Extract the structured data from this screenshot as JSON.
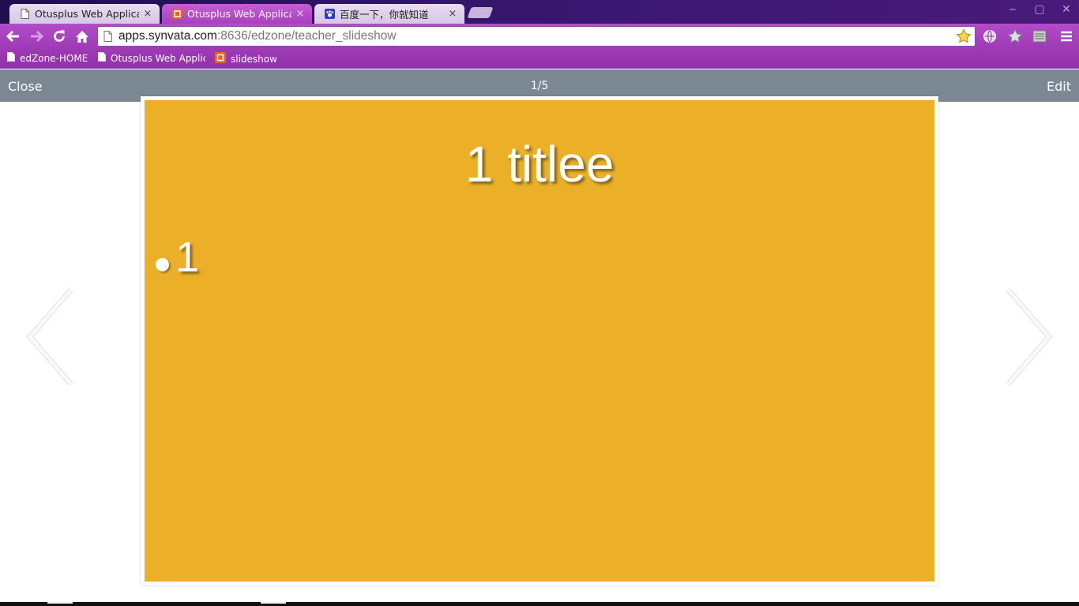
{
  "browser": {
    "tabs": [
      {
        "label": "Otusplus Web Application",
        "close": "×",
        "icon": "page-icon"
      },
      {
        "label": "Otusplus Web Application",
        "close": "×",
        "icon": "slideshow-favicon"
      },
      {
        "label": "百度一下，你就知道",
        "close": "×",
        "icon": "baidu-paw-icon"
      }
    ],
    "window_controls": {
      "minimize": "‒",
      "maximize": "▢",
      "close": "✕"
    },
    "address": {
      "host": "apps.synvata.com",
      "path": ":8636/edzone/teacher_slideshow"
    },
    "bookmarks": [
      {
        "label": "edZone-HOME",
        "icon": "page-icon"
      },
      {
        "label": "Otusplus Web Applic",
        "icon": "page-icon"
      },
      {
        "label": "slideshow",
        "icon": "slideshow-favicon"
      }
    ]
  },
  "slideshow": {
    "close_label": "Close",
    "edit_label": "Edit",
    "counter": "1/5",
    "slide": {
      "title": "1 titlee",
      "bullets": [
        "1"
      ]
    },
    "colors": {
      "header": "#7b8894",
      "slide_background": "#ebb028"
    }
  }
}
